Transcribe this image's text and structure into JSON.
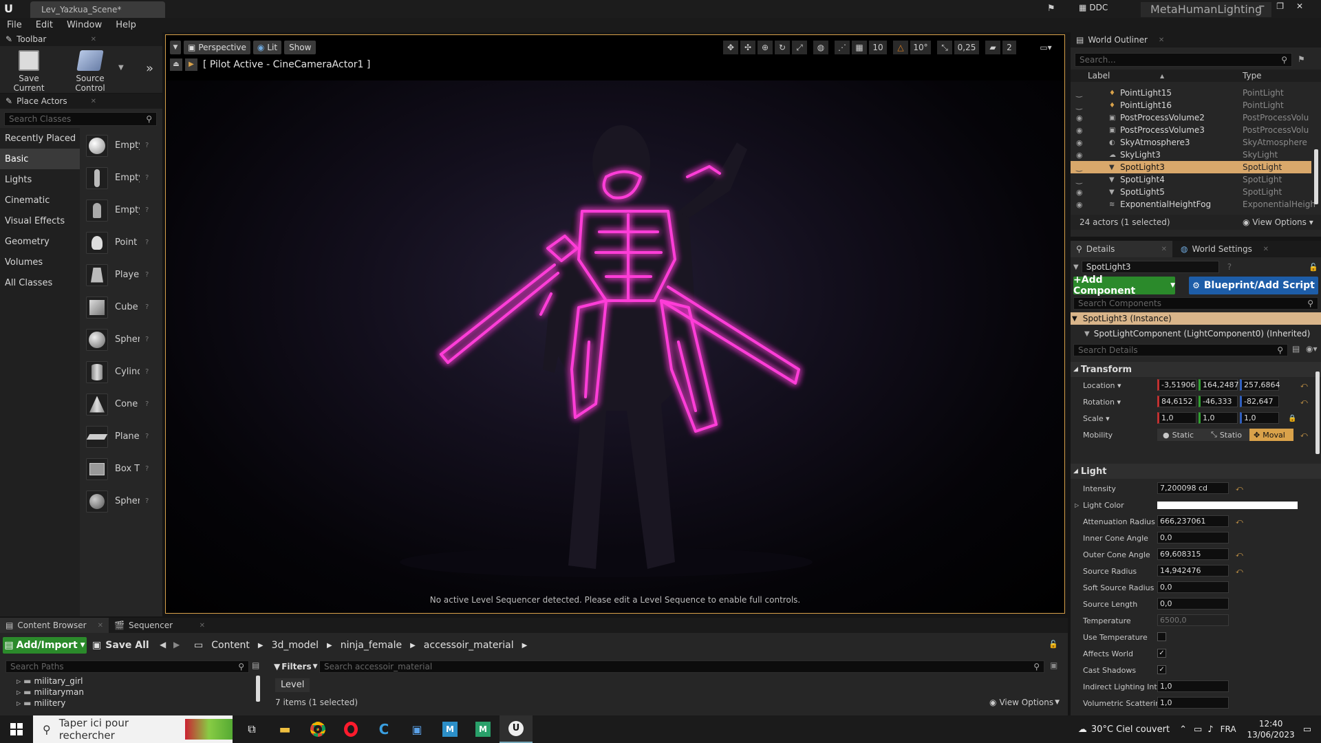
{
  "app": {
    "tab_title": "Lev_Yazkua_Scene*",
    "ddc_label": "DDC",
    "project_name": "MetaHumanLighting"
  },
  "menu": [
    "File",
    "Edit",
    "Window",
    "Help"
  ],
  "toolbar": {
    "title": "Toolbar",
    "save_label": "Save Current",
    "source_control_label": "Source Control"
  },
  "place_actors": {
    "title": "Place Actors",
    "search_placeholder": "Search Classes",
    "categories": [
      "Recently Placed",
      "Basic",
      "Lights",
      "Cinematic",
      "Visual Effects",
      "Geometry",
      "Volumes",
      "All Classes"
    ],
    "selected_category": "Basic",
    "items": [
      "Empty",
      "Empty",
      "Empty",
      "Point l",
      "Player",
      "Cube",
      "Spher",
      "Cylind",
      "Cone",
      "Plane",
      "Box Tı",
      "Spher"
    ]
  },
  "viewport": {
    "perspective": "Perspective",
    "lit": "Lit",
    "show": "Show",
    "pilot": "[ Pilot Active - CineCameraActor1 ]",
    "grid_snap": "10",
    "rot_snap": "10°",
    "scale_snap": "0,25",
    "cam_speed": "2",
    "message": "No active Level Sequencer detected. Please edit a Level Sequence to enable full controls."
  },
  "outliner": {
    "title": "World Outliner",
    "search_placeholder": "Search...",
    "col_label": "Label",
    "col_type": "Type",
    "rows": [
      {
        "label": "PointLight15",
        "type": "PointLight",
        "visible": false
      },
      {
        "label": "PointLight16",
        "type": "PointLight",
        "visible": false
      },
      {
        "label": "PostProcessVolume2",
        "type": "PostProcessVolu",
        "visible": true
      },
      {
        "label": "PostProcessVolume3",
        "type": "PostProcessVolu",
        "visible": true
      },
      {
        "label": "SkyAtmosphere3",
        "type": "SkyAtmosphere",
        "visible": true
      },
      {
        "label": "SkyLight3",
        "type": "SkyLight",
        "visible": true
      },
      {
        "label": "SpotLight3",
        "type": "SpotLight",
        "visible": false
      },
      {
        "label": "SpotLight4",
        "type": "SpotLight",
        "visible": false
      },
      {
        "label": "SpotLight5",
        "type": "SpotLight",
        "visible": true
      },
      {
        "label": "ExponentialHeightFog",
        "type": "ExponentialHeigh",
        "visible": true
      }
    ],
    "selected": "SpotLight3",
    "count": "24 actors (1 selected)",
    "view_options": "View Options"
  },
  "details": {
    "tab_details": "Details",
    "tab_world": "World Settings",
    "name": "SpotLight3",
    "add_component": "+Add Component",
    "blueprint": "Blueprint/Add Script",
    "search_components": "Search Components",
    "instance": "SpotLight3 (Instance)",
    "component": "SpotLightComponent (LightComponent0) (Inherited)",
    "search_details": "Search Details",
    "transform_title": "Transform",
    "location_label": "Location",
    "location": [
      "-3,51906",
      "164,2487",
      "257,6864"
    ],
    "rotation_label": "Rotation",
    "rotation": [
      "84,6152",
      "-46,333",
      "-82,647"
    ],
    "scale_label": "Scale",
    "scale": [
      "1,0",
      "1,0",
      "1,0"
    ],
    "mobility_label": "Mobility",
    "mobility": [
      "Static",
      "Statio",
      "Moval"
    ],
    "light_title": "Light",
    "light_props": [
      {
        "label": "Intensity",
        "value": "7,200098 cd"
      },
      {
        "label": "Light Color",
        "value": ""
      },
      {
        "label": "Attenuation Radius",
        "value": "666,237061"
      },
      {
        "label": "Inner Cone Angle",
        "value": "0,0"
      },
      {
        "label": "Outer Cone Angle",
        "value": "69,608315"
      },
      {
        "label": "Source Radius",
        "value": "14,942476"
      },
      {
        "label": "Soft Source Radius",
        "value": "0,0"
      },
      {
        "label": "Source Length",
        "value": "0,0"
      },
      {
        "label": "Temperature",
        "value": "6500,0"
      },
      {
        "label": "Use Temperature",
        "value": ""
      },
      {
        "label": "Affects World",
        "value": ""
      },
      {
        "label": "Cast Shadows",
        "value": ""
      },
      {
        "label": "Indirect Lighting Inter",
        "value": "1,0"
      },
      {
        "label": "Volumetric Scatterin",
        "value": "1,0"
      }
    ]
  },
  "content_browser": {
    "tab": "Content Browser",
    "tab2": "Sequencer",
    "add_import": "Add/Import",
    "save_all": "Save All",
    "path": [
      "Content",
      "3d_model",
      "ninja_female",
      "accessoir_material"
    ],
    "search_paths": "Search Paths",
    "folders": [
      "military_girl",
      "militaryman",
      "militery"
    ],
    "filters": "Filters",
    "search_assets": "Search accessoir_material",
    "level_chip": "Level",
    "items_count": "7 items (1 selected)",
    "view_options": "View Options"
  },
  "taskbar": {
    "search": "Taper ici pour rechercher",
    "weather": "30°C  Ciel couvert",
    "lang": "FRA",
    "time": "12:40",
    "date": "13/06/2023"
  },
  "colors": {
    "accent_orange": "#d9a24a",
    "selection": "#d9a86b",
    "neon": "#ff3dd8",
    "green_button": "#2b8a2b",
    "blue_button": "#1d5da8"
  }
}
